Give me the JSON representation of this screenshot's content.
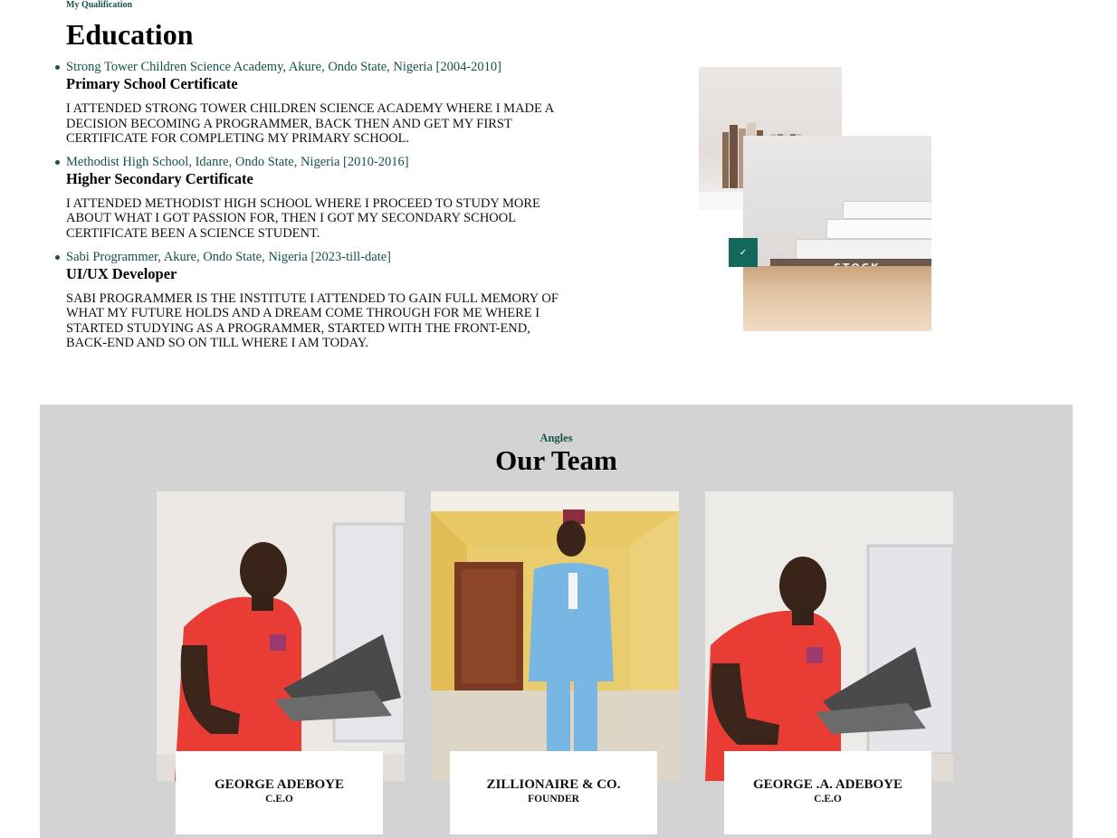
{
  "education": {
    "kicker": "My Qualification",
    "title": "Education",
    "items": [
      {
        "meta": "Strong Tower Children Science Academy, Akure, Ondo State, Nigeria [2004-2010]",
        "certificate": "Primary School Certificate",
        "description": "I ATTENDED STRONG TOWER CHILDREN SCIENCE ACADEMY WHERE I MADE A DECISION BECOMING A PROGRAMMER, BACK THEN AND GET MY FIRST CERTIFICATE FOR COMPLETING MY PRIMARY SCHOOL."
      },
      {
        "meta": "Methodist High School, Idanre, Ondo State, Nigeria [2010-2016]",
        "certificate": "Higher Secondary Certificate",
        "description": "I ATTENDED METHODIST HIGH SCHOOL WHERE I PROCEED TO STUDY MORE ABOUT WHAT I GOT PASSION FOR, THEN I GOT MY SECONDARY SCHOOL CERTIFICATE BEEN A SCIENCE STUDENT."
      },
      {
        "meta": "Sabi Programmer, Akure, Ondo State, Nigeria [2023-till-date]",
        "certificate": "UI/UX Developer",
        "description": "SABI PROGRAMMER IS THE INSTITUTE I ATTENDED TO GAIN FULL MEMORY OF WHAT MY FUTURE HOLDS AND A DREAM COME THROUGH FOR ME WHERE I STARTED STUDYING AS A PROGRAMMER, STARTED WITH THE FRONT-END, BACK-END AND SO ON TILL WHERE I AM TODAY."
      }
    ],
    "photo_text": "STOCK",
    "badge_icon": "check-icon"
  },
  "team": {
    "kicker": "Angles",
    "title": "Our Team",
    "members": [
      {
        "name": "GEORGE ADEBOYE",
        "role": "C.E.O"
      },
      {
        "name": "ZILLIONAIRE & CO.",
        "role": "FOUNDER"
      },
      {
        "name": "GEORGE .A. ADEBOYE",
        "role": "C.E.O"
      }
    ]
  },
  "colors": {
    "accent": "#16514a",
    "badge": "#12695b",
    "team_background": "#d3d3d3"
  }
}
